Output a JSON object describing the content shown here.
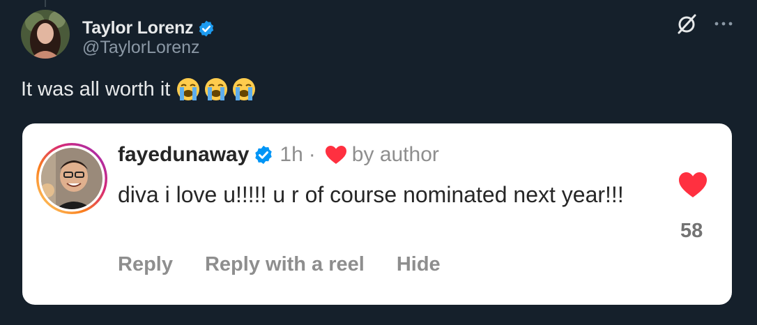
{
  "tweet": {
    "author_name": "Taylor Lorenz",
    "author_handle": "@TaylorLorenz",
    "text": "It was all worth it",
    "emojis": [
      "loudly-crying-face",
      "loudly-crying-face",
      "loudly-crying-face"
    ]
  },
  "comment": {
    "username": "fayedunaway",
    "time": "1h",
    "separator": "·",
    "liked_by_label": "by author",
    "text": "diva i love u!!!!! u r of course nominated next year!!!",
    "like_count": "58",
    "actions": {
      "reply": "Reply",
      "reply_with_reel": "Reply with a reel",
      "hide": "Hide"
    }
  },
  "colors": {
    "background": "#15202b",
    "verified": "#1d9bf0",
    "heart": "#ff3040",
    "card": "#ffffff"
  }
}
